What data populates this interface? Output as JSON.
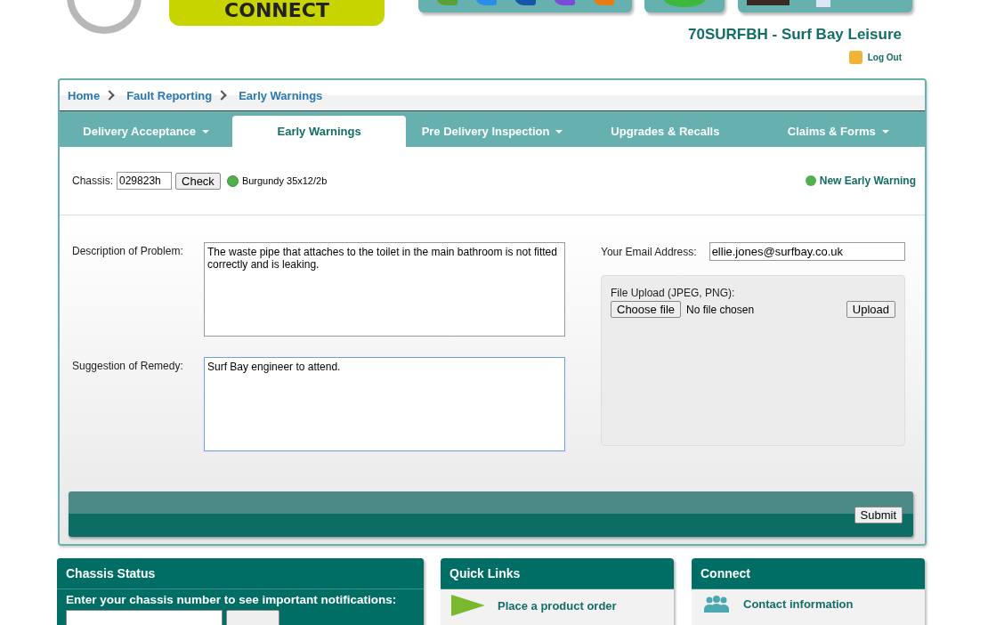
{
  "header": {
    "logo_text": "CONNECT",
    "account": "70SURFBH - Surf Bay Leisure",
    "logout": "Log Out"
  },
  "breadcrumb": [
    "Home",
    "Fault Reporting",
    "Early Warnings"
  ],
  "tabs": [
    {
      "label": "Delivery Acceptance",
      "selected": false,
      "dropdown": true
    },
    {
      "label": "Early Warnings",
      "selected": true,
      "dropdown": false
    },
    {
      "label": "Pre Delivery Inspection",
      "selected": false,
      "dropdown": true
    },
    {
      "label": "Upgrades & Recalls",
      "selected": false,
      "dropdown": false
    },
    {
      "label": "Claims & Forms",
      "selected": false,
      "dropdown": true
    }
  ],
  "chassis": {
    "label": "Chassis:",
    "value": "029823h",
    "button": "Check",
    "result": "Burgundy 35x12/2b",
    "new_link": "New Early Warning"
  },
  "form": {
    "description_label": "Description of Problem:",
    "description": "The waste pipe that attaches to the toilet in the main bathroom is not fitted correctly and is leaking.",
    "remedy_label": "Suggestion of Remedy:",
    "remedy": "Surf Bay engineer to attend.",
    "email_label": "Your Email Address:",
    "email": "ellie.jones@surfbay.co.uk",
    "upload_label": "File Upload (JPEG, PNG):",
    "choose_button": "Choose file",
    "no_file": "No file chosen",
    "upload_button": "Upload",
    "submit": "Submit"
  },
  "chassis_status": {
    "title": "Chassis Status",
    "prompt": "Enter your chassis number to see important notifications:"
  },
  "quick_links": {
    "title": "Quick Links",
    "items": [
      "Place a product order"
    ]
  },
  "connect": {
    "title": "Connect",
    "items": [
      "Contact information"
    ]
  }
}
